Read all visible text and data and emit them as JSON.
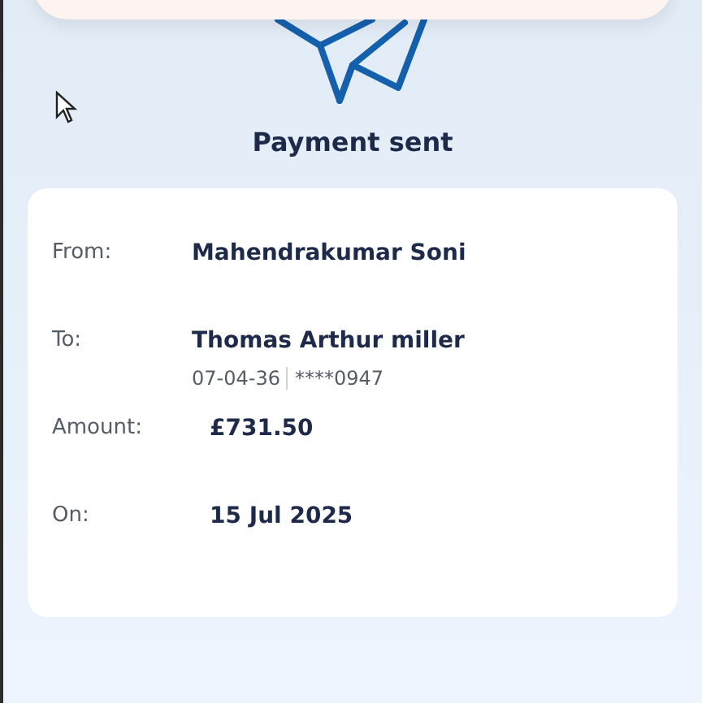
{
  "title": "Payment sent",
  "details": [
    {
      "label": "From:",
      "value": "Mahendrakumar Soni"
    },
    {
      "label": "To:",
      "value": "Thomas Arthur miller",
      "sort_code": "07-04-36",
      "account": "****0947"
    },
    {
      "label": "Amount:",
      "value": "£731.50"
    },
    {
      "label": "On:",
      "value": "15 Jul 2025"
    }
  ]
}
